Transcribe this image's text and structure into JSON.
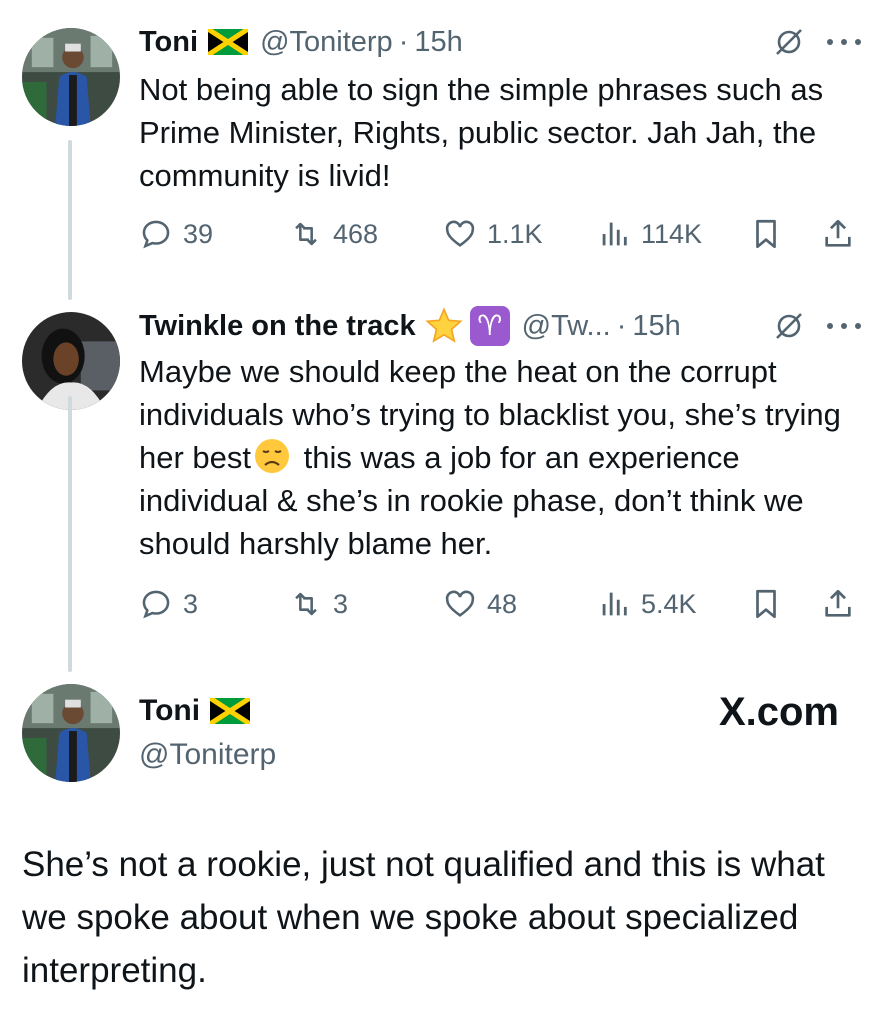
{
  "tweets": [
    {
      "name": "Toni",
      "handle": "@Toniterp",
      "sep": "·",
      "time": "15h",
      "text": "Not being able to sign the simple phrases such as Prime Minister, Rights, public sector. Jah Jah, the community is livid!",
      "stats": {
        "replies": "39",
        "reposts": "468",
        "likes": "1.1K",
        "views": "114K"
      }
    },
    {
      "name": "Twinkle on the track",
      "handle": "@Tw...",
      "sep": "·",
      "time": "15h",
      "text_part1": "Maybe we should keep the heat on the corrupt individuals who’s trying to blacklist you, she’s trying her best",
      "text_part2": " this was a job for an experience individual & she’s in rookie phase, don’t think we should harshly blame her.",
      "stats": {
        "replies": "3",
        "reposts": "3",
        "likes": "48",
        "views": "5.4K"
      }
    }
  ],
  "card": {
    "name": "Toni",
    "handle": "@Toniterp",
    "brand": "X.com",
    "quote": "She’s not a rookie, just not qualified and this is what we spoke about when we spoke about specialized interpreting."
  },
  "colors": {
    "text": "#0f1419",
    "muted": "#536471",
    "thread": "#cfd9de",
    "jamaica_green": "#009b3a",
    "jamaica_gold": "#fed100"
  }
}
